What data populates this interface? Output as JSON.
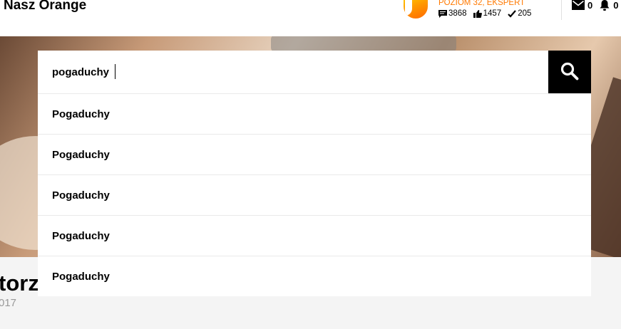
{
  "header": {
    "site_title": "Nasz Orange",
    "user": {
      "rank": "POZIOM 32, EKSPERT",
      "posts": "3868",
      "likes": "1457",
      "solutions": "205"
    },
    "messages_count": "0",
    "notifications_count": "0"
  },
  "search": {
    "value": "pogaduchy",
    "suggestions": [
      "Pogaduchy",
      "Pogaduchy",
      "Pogaduchy",
      "Pogaduchy",
      "Pogaduchy"
    ]
  },
  "content": {
    "title_fragment": "torz",
    "date_fragment": "017"
  },
  "colors": {
    "accent": "#ff7900",
    "search_button": "#000000"
  }
}
